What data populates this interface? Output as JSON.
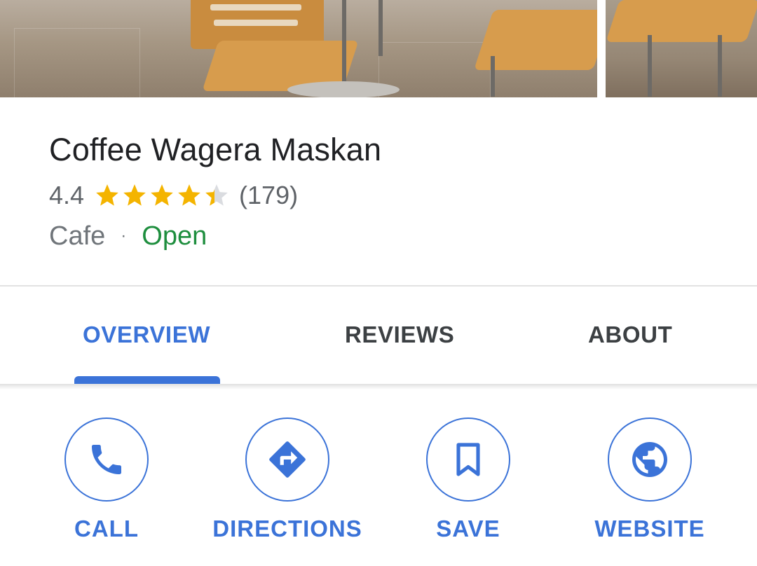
{
  "place": {
    "name": "Coffee Wagera Maskan",
    "rating": "4.4",
    "rating_value": 4.4,
    "stars_max": 5,
    "review_count": "(179)",
    "category": "Cafe",
    "separator": "·",
    "status": "Open"
  },
  "tabs": [
    {
      "label": "OVERVIEW",
      "active": true
    },
    {
      "label": "REVIEWS",
      "active": false
    },
    {
      "label": "ABOUT",
      "active": false
    }
  ],
  "actions": [
    {
      "label": "CALL",
      "icon": "phone-icon"
    },
    {
      "label": "DIRECTIONS",
      "icon": "directions-icon"
    },
    {
      "label": "SAVE",
      "icon": "bookmark-icon"
    },
    {
      "label": "WEBSITE",
      "icon": "globe-icon"
    }
  ],
  "colors": {
    "accent": "#3b73d8",
    "star": "#f4b400",
    "star_empty": "#dadce0",
    "open": "#1e8e3e"
  }
}
